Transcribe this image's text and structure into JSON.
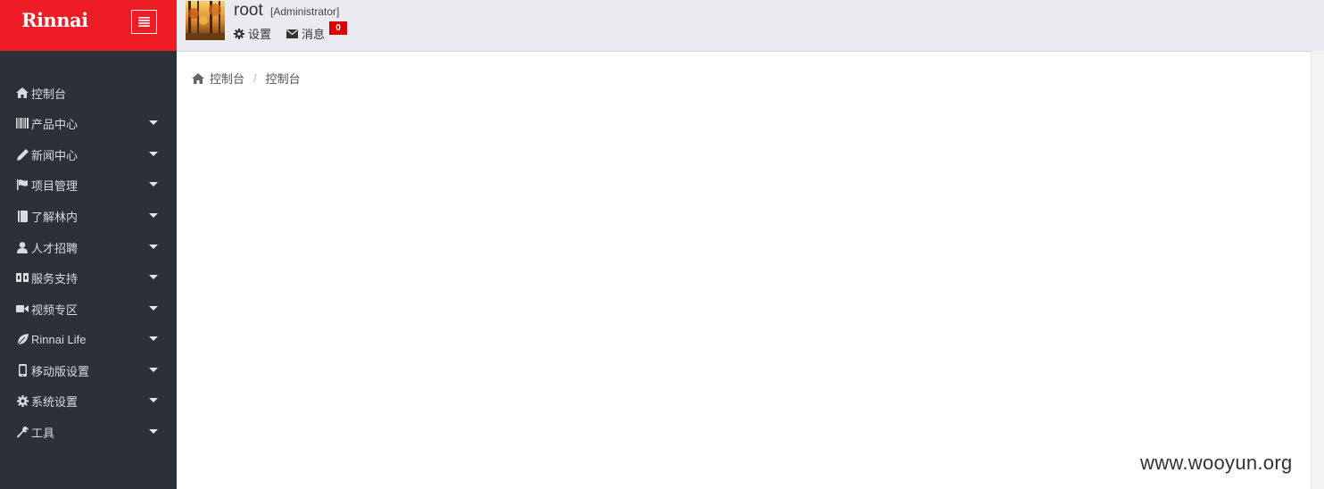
{
  "brand": {
    "logo_text": "Rinnai",
    "accent_color": "#ee1c25"
  },
  "header": {
    "user_name": "root",
    "user_role": "[Administrator]",
    "settings_label": "设置",
    "messages_label": "消息",
    "message_count": "0"
  },
  "sidebar": {
    "background": "#2c3038",
    "items": [
      {
        "label": "控制台",
        "icon": "home-icon",
        "has_submenu": false
      },
      {
        "label": "产品中心",
        "icon": "barcode-icon",
        "has_submenu": true
      },
      {
        "label": "新闻中心",
        "icon": "pencil-icon",
        "has_submenu": true
      },
      {
        "label": "项目管理",
        "icon": "flag-icon",
        "has_submenu": true
      },
      {
        "label": "了解林内",
        "icon": "book-icon",
        "has_submenu": true
      },
      {
        "label": "人才招聘",
        "icon": "user-icon",
        "has_submenu": true
      },
      {
        "label": "服务支持",
        "icon": "shield-icon",
        "has_submenu": true
      },
      {
        "label": "视频专区",
        "icon": "video-icon",
        "has_submenu": true
      },
      {
        "label": "Rinnai Life",
        "icon": "leaf-icon",
        "has_submenu": true
      },
      {
        "label": "移动版设置",
        "icon": "mobile-icon",
        "has_submenu": true
      },
      {
        "label": "系统设置",
        "icon": "gear-icon",
        "has_submenu": true
      },
      {
        "label": "工具",
        "icon": "wrench-icon",
        "has_submenu": true
      }
    ]
  },
  "breadcrumb": {
    "home": "控制台",
    "current": "控制台"
  },
  "watermark": "www.wooyun.org"
}
